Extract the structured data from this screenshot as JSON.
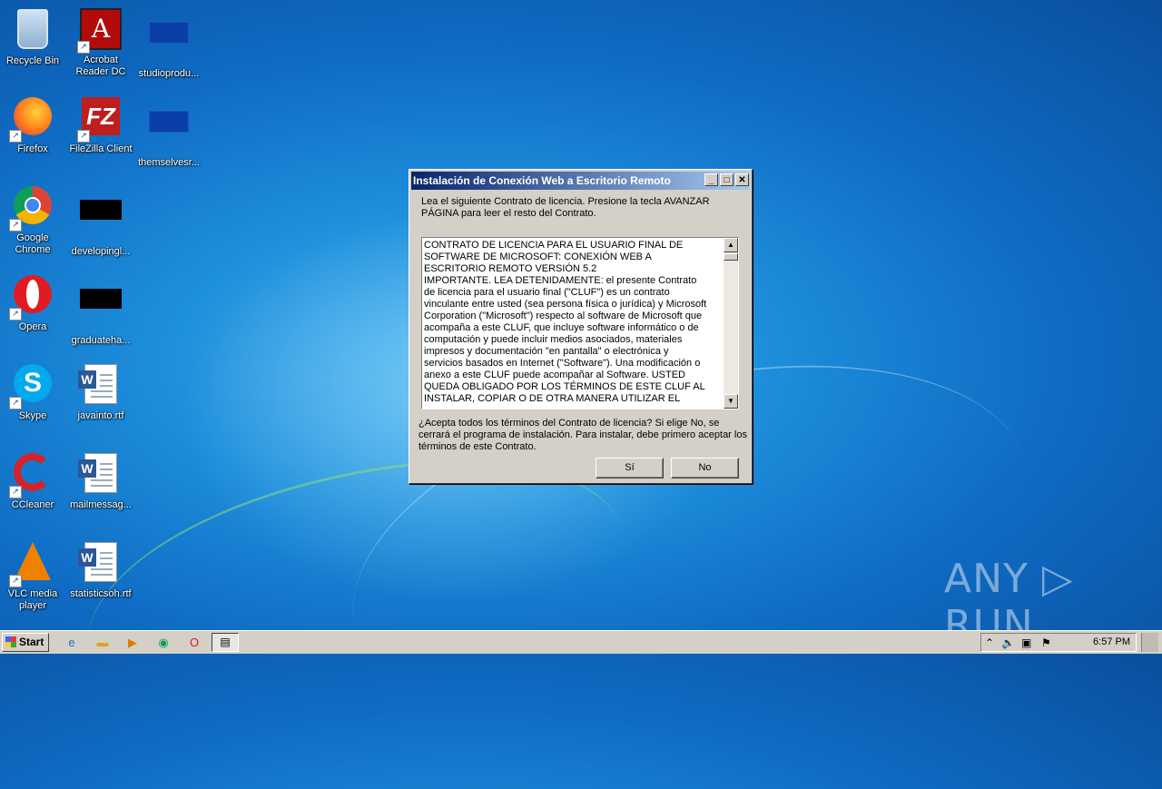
{
  "desktop": {
    "icons": [
      {
        "label": "Recycle Bin",
        "icon": "recycle-bin-icon"
      },
      {
        "label": "Acrobat\nReader DC",
        "icon": "acrobat-icon"
      },
      {
        "label": "studioprodu...",
        "icon": "file-icon"
      },
      {
        "label": "Firefox",
        "icon": "firefox-icon"
      },
      {
        "label": "FileZilla Client",
        "icon": "filezilla-icon"
      },
      {
        "label": "themselvesr...",
        "icon": "file-icon"
      },
      {
        "label": "Google\nChrome",
        "icon": "chrome-icon"
      },
      {
        "label": "developingl...",
        "icon": "file-icon"
      },
      {
        "label": "Opera",
        "icon": "opera-icon"
      },
      {
        "label": "graduateha...",
        "icon": "file-icon"
      },
      {
        "label": "Skype",
        "icon": "skype-icon"
      },
      {
        "label": "javainto.rtf",
        "icon": "word-document-icon"
      },
      {
        "label": "CCleaner",
        "icon": "ccleaner-icon"
      },
      {
        "label": "mailmessag...",
        "icon": "word-document-icon"
      },
      {
        "label": "VLC media\nplayer",
        "icon": "vlc-icon"
      },
      {
        "label": "statisticsoh.rtf",
        "icon": "word-document-icon"
      }
    ]
  },
  "dialog": {
    "title": "Instalación de Conexión Web a Escritorio Remoto",
    "intro": "Lea el siguiente Contrato de licencia. Presione la tecla AVANZAR PÁGINA para leer el resto del Contrato.",
    "license_text": "CONTRATO DE LICENCIA PARA EL USUARIO FINAL DE\nSOFTWARE DE MICROSOFT: CONEXIÓN WEB A\nESCRITORIO REMOTO VERSIÓN 5.2\nIMPORTANTE. LEA DETENIDAMENTE: el presente Contrato\nde licencia para el usuario final (\"CLUF\") es un contrato\nvinculante entre usted (sea persona física o jurídica) y Microsoft\nCorporation (\"Microsoft\") respecto al software de Microsoft que\nacompaña a este CLUF, que incluye software informático o de\ncomputación y puede incluir medios asociados, materiales\nimpresos y documentación \"en pantalla\" o electrónica y\nservicios basados en Internet (\"Software\"). Una modificación o\nanexo a este CLUF puede acompañar al Software. USTED\nQUEDA OBLIGADO POR LOS TÉRMINOS DE ESTE CLUF AL\nINSTALAR, COPIAR O DE OTRA MANERA UTILIZAR EL",
    "question": "¿Acepta todos los términos del Contrato de licencia? Si elige No, se cerrará el programa de instalación. Para instalar, debe primero aceptar los términos de este Contrato.",
    "yes_label": "Sí",
    "no_label": "No"
  },
  "watermark": "ANY ▷ RUN",
  "taskbar": {
    "start_label": "Start",
    "clock": "6:57 PM"
  }
}
